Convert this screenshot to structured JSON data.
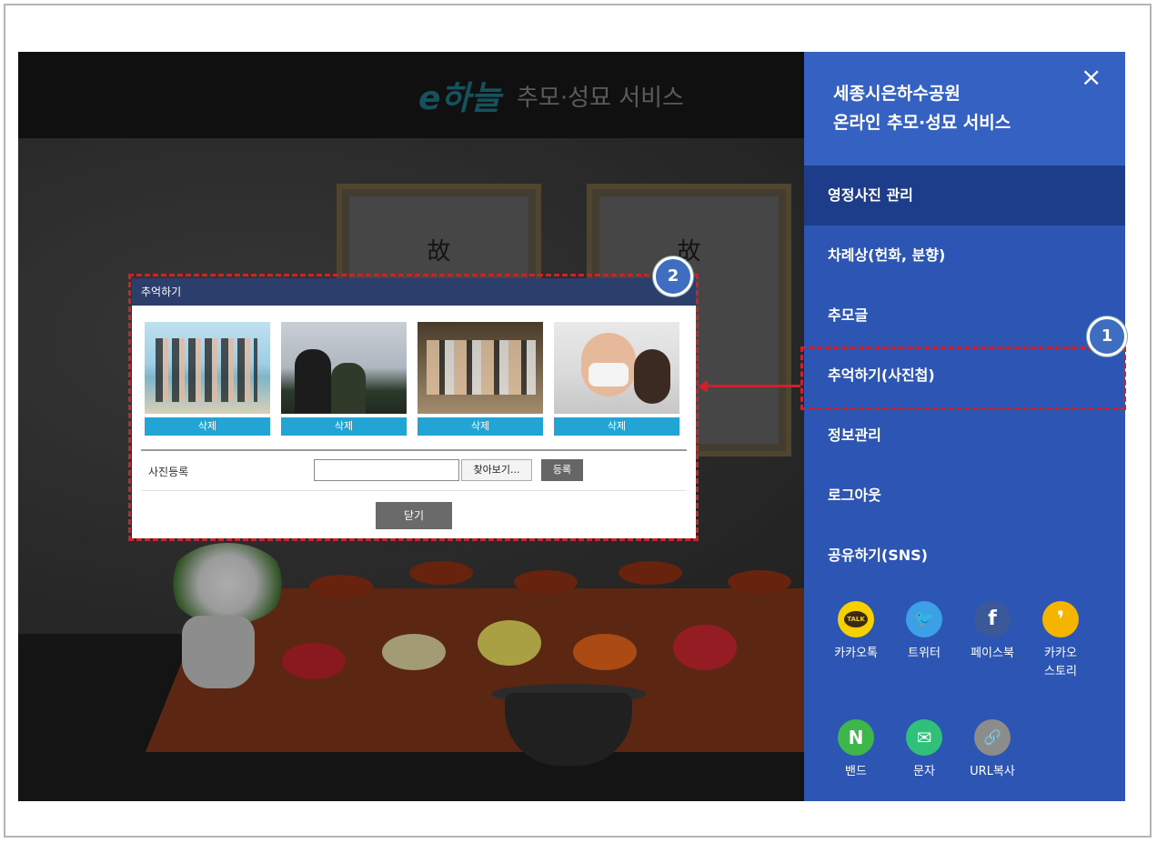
{
  "header": {
    "logo_mark": "e하늘",
    "service_title": "추모·성묘 서비스"
  },
  "shrine": {
    "frame1_glyph": "故",
    "frame2_glyph": "故"
  },
  "popup": {
    "title": "추억하기",
    "photos": [
      {
        "delete_label": "삭제"
      },
      {
        "delete_label": "삭제"
      },
      {
        "delete_label": "삭제"
      },
      {
        "delete_label": "삭제"
      }
    ],
    "register_label": "사진등록",
    "file_value": "",
    "browse_label": "찾아보기...",
    "submit_label": "등록",
    "close_label": "닫기"
  },
  "callouts": {
    "badge1": "1",
    "badge2": "2"
  },
  "panel": {
    "title_line1": "세종시은하수공원",
    "title_line2": "온라인 추모·성묘 서비스",
    "close_icon": "×",
    "menu": [
      {
        "label": "영정사진 관리",
        "active": true
      },
      {
        "label": "차례상(헌화, 분향)"
      },
      {
        "label": "추모글"
      },
      {
        "label": "추억하기(사진첩)"
      },
      {
        "label": "정보관리"
      },
      {
        "label": "로그아웃"
      },
      {
        "label": "공유하기(SNS)"
      }
    ],
    "sns": [
      {
        "label_line1": "카카오톡",
        "label_line2": "",
        "icon": "kakaotalk-icon",
        "glyph": "TALK",
        "color": "#f7d000"
      },
      {
        "label_line1": "트위터",
        "label_line2": "",
        "icon": "twitter-icon",
        "glyph": "🐦",
        "color": "#3ba0e6"
      },
      {
        "label_line1": "페이스북",
        "label_line2": "",
        "icon": "facebook-icon",
        "glyph": "f",
        "color": "#3b5998"
      },
      {
        "label_line1": "카카오",
        "label_line2": "스토리",
        "icon": "kakaostory-icon",
        "glyph": "❜",
        "color": "#f5b400"
      },
      {
        "label_line1": "밴드",
        "label_line2": "",
        "icon": "band-icon",
        "glyph": "N",
        "color": "#3fb64a"
      },
      {
        "label_line1": "문자",
        "label_line2": "",
        "icon": "sms-icon",
        "glyph": "✉",
        "color": "#2fc17a"
      },
      {
        "label_line1": "URL복사",
        "label_line2": "",
        "icon": "link-icon",
        "glyph": "🔗",
        "color": "#8c8c8c"
      }
    ]
  }
}
